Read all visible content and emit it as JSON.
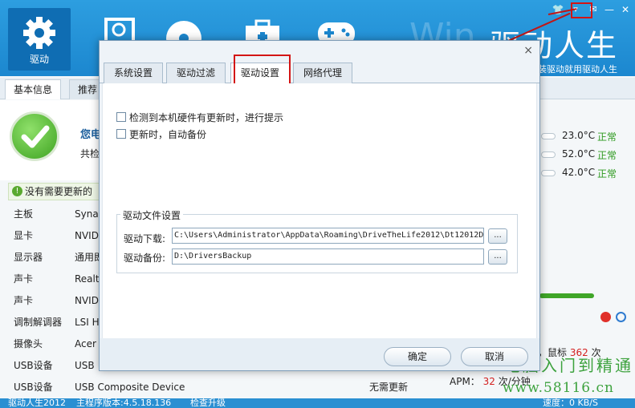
{
  "header": {
    "brand": "驱动人生",
    "watermark": "Win",
    "slogan": "装驱动就用驱动人生",
    "nav_active_label": "驱动"
  },
  "main_tabs": [
    "基本信息",
    "推荐"
  ],
  "summary": {
    "title": "您电",
    "line2": "共检"
  },
  "notice": "没有需要更新的",
  "hardware": [
    {
      "name": "主板",
      "value": "Synap",
      "status": ""
    },
    {
      "name": "显卡",
      "value": "NVID",
      "status": ""
    },
    {
      "name": "显示器",
      "value": "通用即",
      "status": ""
    },
    {
      "name": "声卡",
      "value": "Realt",
      "status": ""
    },
    {
      "name": "声卡",
      "value": "NVID",
      "status": ""
    },
    {
      "name": "调制解调器",
      "value": "LSI H",
      "status": ""
    },
    {
      "name": "摄像头",
      "value": "Acer",
      "status": ""
    },
    {
      "name": "USB设备",
      "value": "USB",
      "status": ""
    },
    {
      "name": "USB设备",
      "value": "USB Composite Device",
      "status": "无需更新"
    }
  ],
  "temps": [
    {
      "value": "23.0°C",
      "status": "正常"
    },
    {
      "value": "52.0°C",
      "status": "正常"
    },
    {
      "value": "42.0°C",
      "status": "正常"
    }
  ],
  "stats": {
    "mouse_prefix": "，鼠标",
    "mouse_count": "362",
    "mouse_unit": "次",
    "apm_label": "APM：",
    "apm_value": "32",
    "apm_unit": "次/分钟"
  },
  "statusbar": {
    "app": "驱动人生2012",
    "version": "主程序版本:4.5.18.136",
    "check": "检查升级",
    "speed": "速度：0 KB/S"
  },
  "site_watermark": {
    "text": "电脑入门到精通",
    "url": "www.58116.cn"
  },
  "dialog": {
    "close": "×",
    "tabs": [
      "系统设置",
      "驱动过滤",
      "驱动设置",
      "网络代理"
    ],
    "active_tab": 2,
    "check1": "检测到本机硬件有更新时，进行提示",
    "check2": "更新时，自动备份",
    "group_title": "驱动文件设置",
    "download_label": "驱动下载:",
    "download_path": "C:\\Users\\Administrator\\AppData\\Roaming\\DriveTheLife2012\\Dt12012D",
    "backup_label": "驱动备份:",
    "backup_path": "D:\\DriversBackup",
    "browse": "...",
    "ok": "确定",
    "cancel": "取消"
  },
  "colors": {
    "accent": "#1c87cf",
    "highlight": "#d31515",
    "ok_green": "#2d9a1e"
  }
}
